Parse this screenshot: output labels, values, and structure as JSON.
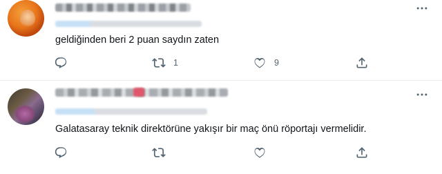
{
  "tweets": [
    {
      "text": "geldiğinden beri 2 puan saydın zaten",
      "reply_count": "",
      "retweet_count": "1",
      "like_count": "9"
    },
    {
      "text": "Galatasaray teknik direktörüne yakışır bir maç önü röportajı vermelidir.",
      "reply_count": "",
      "retweet_count": "",
      "like_count": ""
    }
  ],
  "colors": {
    "text": "#0f1419",
    "icon_gray": "#536471",
    "divider": "#e6ecf0"
  },
  "icons": [
    "more-icon",
    "reply-icon",
    "retweet-icon",
    "like-icon",
    "share-icon"
  ]
}
